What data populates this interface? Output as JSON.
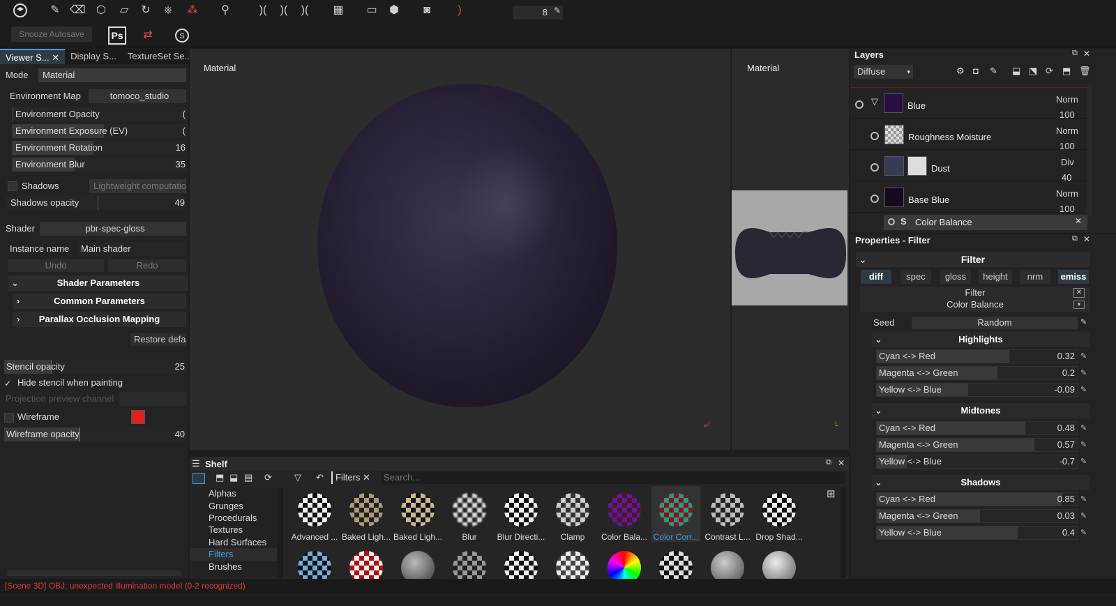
{
  "toolbar": {
    "snooze_label": "Snooze Autosave",
    "ps_label": "Ps",
    "brush_size": "8",
    "icons": [
      "logo-icon",
      "paint-icon",
      "eraser-icon",
      "projection-icon",
      "polygon-fill-icon",
      "smudge-icon",
      "clone-icon",
      "particle-icon",
      "picker-icon",
      "symmetry-icon",
      "camera-icon",
      "view-2d3d-icon",
      "render-icon"
    ]
  },
  "left_panel": {
    "tabs": [
      "Viewer S...",
      "Display S...",
      "TextureSet Se..."
    ],
    "mode_label": "Mode",
    "mode_value": "Material",
    "env_map_label": "Environment Map",
    "env_map_value": "tomoco_studio",
    "env_opacity": "Environment Opacity",
    "env_opacity_val": "(",
    "env_exposure": "Environment Exposure (EV)",
    "env_exposure_val": "(",
    "env_rotation": "Environment Rotation",
    "env_rotation_val": "16",
    "env_blur": "Environment Blur",
    "env_blur_val": "35",
    "shadows_label": "Shadows",
    "shadows_mode": "Lightweight computatio",
    "shadows_opacity": "Shadows opacity",
    "shadows_opacity_val": "49",
    "shader_label": "Shader",
    "shader_value": "pbr-spec-gloss",
    "instance_label": "Instance name",
    "instance_value": "Main shader",
    "undo": "Undo",
    "redo": "Redo",
    "shader_params": "Shader Parameters",
    "common_params": "Common Parameters",
    "parallax": "Parallax Occlusion Mapping",
    "restore": "Restore defa",
    "stencil_opacity": "Stencil opacity",
    "stencil_opacity_val": "25",
    "hide_stencil": "Hide stencil when painting",
    "projection_preview": "Projection preview channel",
    "wireframe": "Wireframe",
    "wireframe_color": "#e02020",
    "wireframe_opacity": "Wireframe opacity",
    "wireframe_opacity_val": "40"
  },
  "viewport": {
    "label_3d": "Material",
    "label_2d": "Material",
    "sphere_color": "#2b2438"
  },
  "shelf": {
    "title": "Shelf",
    "filter_tag": "Filters",
    "search_placeholder": "Search...",
    "categories": [
      "Alphas",
      "Grunges",
      "Procedurals",
      "Textures",
      "Hard Surfaces",
      "Filters",
      "Brushes"
    ],
    "active_category": "Filters",
    "items": [
      "Advanced ...",
      "Baked Ligh...",
      "Baked Ligh...",
      "Blur",
      "Blur Directi...",
      "Clamp",
      "Color Bala...",
      "Color Corr...",
      "Contrast L...",
      "Drop Shad..."
    ]
  },
  "layers": {
    "title": "Layers",
    "channel": "Diffuse",
    "items": [
      {
        "name": "Blue",
        "blend": "Norm",
        "opacity": "100",
        "color": "#2a1040"
      },
      {
        "name": "Roughness Moisture",
        "blend": "Norm",
        "opacity": "100",
        "color": "#cccccc"
      },
      {
        "name": "Dust",
        "blend": "Div",
        "opacity": "40",
        "color": "#dddddd"
      },
      {
        "name": "Base Blue",
        "blend": "Norm",
        "opacity": "100",
        "color": "#15081f"
      }
    ],
    "effect": "Color Balance"
  },
  "properties": {
    "title": "Properties - Filter",
    "filter_header": "Filter",
    "channels": [
      "diff",
      "spec",
      "gloss",
      "height",
      "nrm",
      "emiss"
    ],
    "filter_label": "Filter",
    "filter_name": "Color Balance",
    "seed_label": "Seed",
    "seed_value": "Random",
    "groups": [
      {
        "name": "Highlights",
        "sliders": [
          {
            "label": "Cyan <-> Red",
            "value": "0.32",
            "level": 0.66
          },
          {
            "label": "Magenta <-> Green",
            "value": "0.2",
            "level": 0.6
          },
          {
            "label": "Yellow <-> Blue",
            "value": "-0.09",
            "level": 0.455
          }
        ]
      },
      {
        "name": "Midtones",
        "sliders": [
          {
            "label": "Cyan <-> Red",
            "value": "0.48",
            "level": 0.74
          },
          {
            "label": "Magenta <-> Green",
            "value": "0.57",
            "level": 0.785
          },
          {
            "label": "Yellow <-> Blue",
            "value": "-0.7",
            "level": 0.15
          }
        ]
      },
      {
        "name": "Shadows",
        "sliders": [
          {
            "label": "Cyan <-> Red",
            "value": "0.85",
            "level": 0.925
          },
          {
            "label": "Magenta <-> Green",
            "value": "0.03",
            "level": 0.515
          },
          {
            "label": "Yellow <-> Blue",
            "value": "0.4",
            "level": 0.7
          }
        ]
      }
    ]
  },
  "status": "[Scene 3D] OBJ: unexpected illumination model (0-2 recognized)"
}
